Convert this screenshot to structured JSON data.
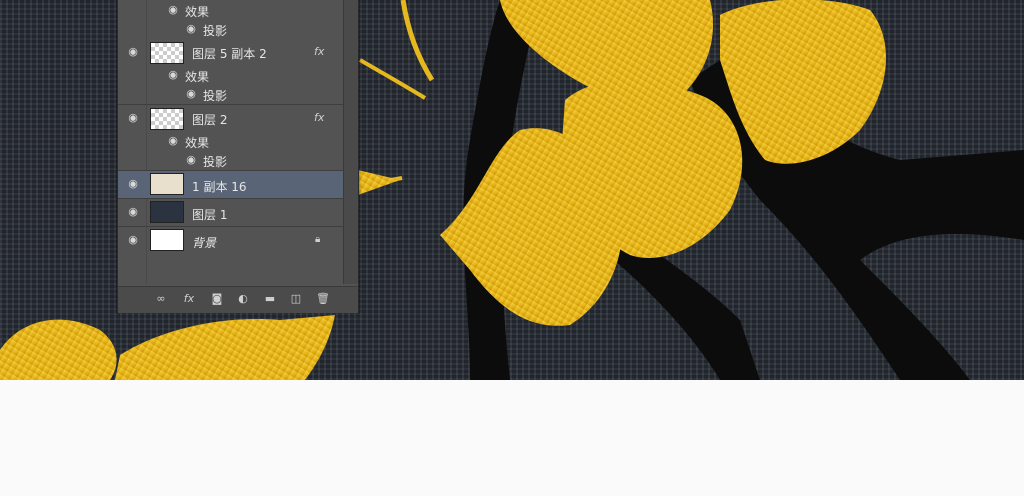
{
  "layers_panel": {
    "layers": [
      {
        "name": "图层 5 副本 2",
        "has_fx": true,
        "fx_label": "fx",
        "effects_label": "效果",
        "effect": "投影"
      },
      {
        "name": "图层 2",
        "has_fx": true,
        "fx_label": "fx",
        "effects_label": "效果",
        "effect": "投影"
      },
      {
        "name": "1 副本 16",
        "selected": true
      },
      {
        "name": "图层 1"
      },
      {
        "name": "背景",
        "locked": true
      }
    ],
    "top_effects_label": "效果",
    "top_effect": "投影",
    "bottom_bar_icons": [
      "link-icon",
      "fx-icon",
      "mask-icon",
      "adjustment-icon",
      "folder-icon",
      "new-layer-icon",
      "trash-icon"
    ],
    "fx_bar_label": "fx"
  },
  "canvas": {
    "leaf_color": "#f0c020",
    "branch_color": "#0d0d0d",
    "background_color": "#2a2f38"
  }
}
